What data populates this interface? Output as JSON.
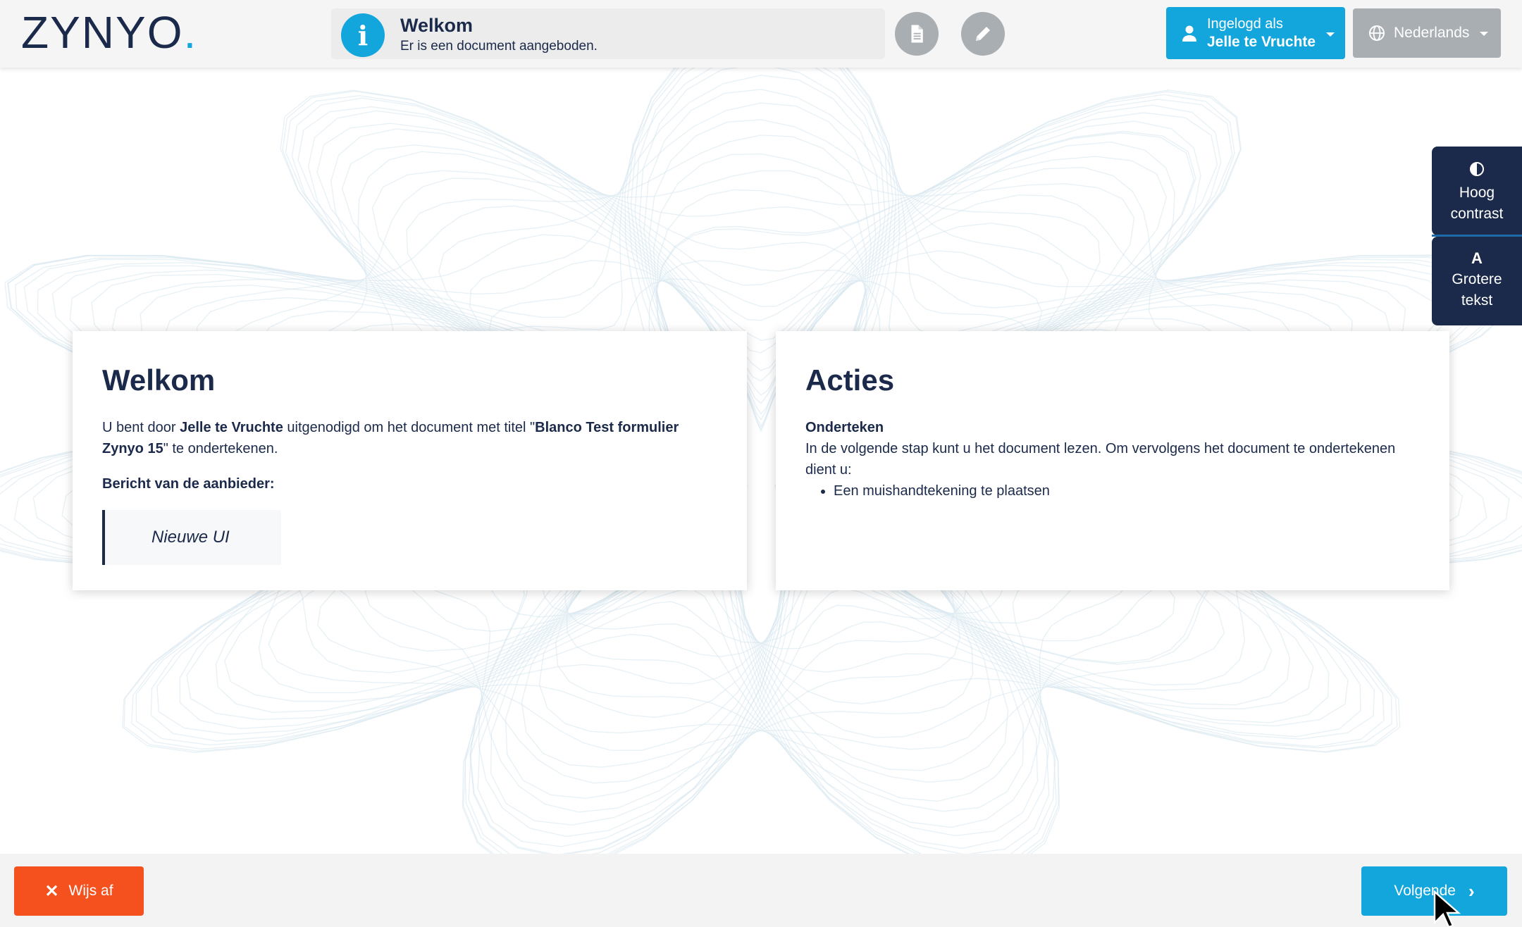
{
  "brand": {
    "logo_text": "ZYNYO",
    "logo_dot": "."
  },
  "notice": {
    "icon": "info-icon",
    "icon_glyph": "i",
    "title": "Welkom",
    "subtitle": "Er is een document aangeboden."
  },
  "toolbar": {
    "document_icon": "document-icon",
    "sign_icon": "pencil-icon"
  },
  "user": {
    "line1": "Ingelogd als",
    "name": "Jelle te Vruchte"
  },
  "language": {
    "selected": "Nederlands"
  },
  "accessibility": {
    "contrast_line1": "Hoog",
    "contrast_line2": "contrast",
    "text_icon": "A",
    "text_line1": "Grotere",
    "text_line2": "tekst"
  },
  "welcome": {
    "heading": "Welkom",
    "intro_pre": "U bent door ",
    "inviter": "Jelle te Vruchte",
    "intro_mid": " uitgenodigd om het document met titel \"",
    "doc_title": "Blanco Test formulier Zynyo 15",
    "intro_post": "\" te ondertekenen.",
    "message_label": "Bericht van de aanbieder:",
    "message": "Nieuwe UI"
  },
  "actions": {
    "heading": "Acties",
    "step_title": "Onderteken",
    "step_text": "In de volgende stap kunt u het document lezen. Om vervolgens het document te ondertekenen dient u:",
    "items": [
      "Een muishandtekening te plaatsen"
    ]
  },
  "footer": {
    "reject_label": "Wijs af",
    "next_label": "Volgende"
  },
  "colors": {
    "primary": "#13a6dc",
    "navy": "#1b2a4a",
    "danger": "#f4511e",
    "neutral": "#a9aeb3"
  }
}
